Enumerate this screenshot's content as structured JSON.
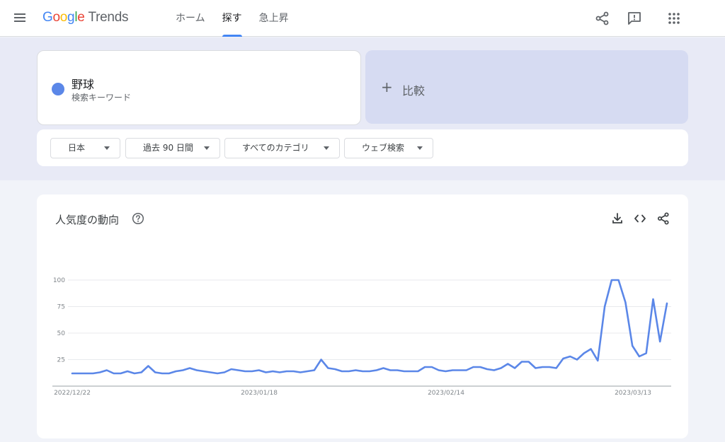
{
  "header": {
    "logo": {
      "g": "G",
      "o1": "o",
      "o2": "o",
      "g2": "g",
      "l": "l",
      "e": "e",
      "trends": "Trends"
    },
    "nav": [
      {
        "label": "ホーム",
        "active": false
      },
      {
        "label": "探す",
        "active": true
      },
      {
        "label": "急上昇",
        "active": false
      }
    ]
  },
  "search": {
    "term": "野球",
    "term_type": "検索キーワード",
    "term_color": "#5b87e8",
    "compare_label": "比較"
  },
  "filters": {
    "region": "日本",
    "period": "過去 90 日間",
    "category": "すべてのカテゴリ",
    "search_type": "ウェブ検索"
  },
  "card": {
    "title": "人気度の動向"
  },
  "chart_data": {
    "type": "line",
    "series": [
      {
        "color": "#5b87e8",
        "values": [
          12,
          12,
          12,
          12,
          13,
          15,
          12,
          12,
          14,
          12,
          13,
          19,
          13,
          12,
          12,
          14,
          15,
          17,
          15,
          14,
          13,
          12,
          13,
          16,
          15,
          14,
          14,
          15,
          13,
          14,
          13,
          14,
          14,
          13,
          14,
          15,
          25,
          17,
          16,
          14,
          14,
          15,
          14,
          14,
          15,
          17,
          15,
          15,
          14,
          14,
          14,
          18,
          18,
          15,
          14,
          15,
          15,
          15,
          18,
          18,
          16,
          15,
          17,
          21,
          17,
          23,
          23,
          17,
          18,
          18,
          17,
          26,
          28,
          25,
          31,
          35,
          24,
          75,
          100,
          100,
          79,
          38,
          28,
          31,
          82,
          42,
          78
        ]
      }
    ],
    "y_ticks": [
      "100",
      "75",
      "50",
      "25"
    ],
    "x_tick_labels": [
      "2022/12/22",
      "2023/01/18",
      "2023/02/14",
      "2023/03/13"
    ],
    "ylim": [
      0,
      100
    ],
    "grid": true
  }
}
